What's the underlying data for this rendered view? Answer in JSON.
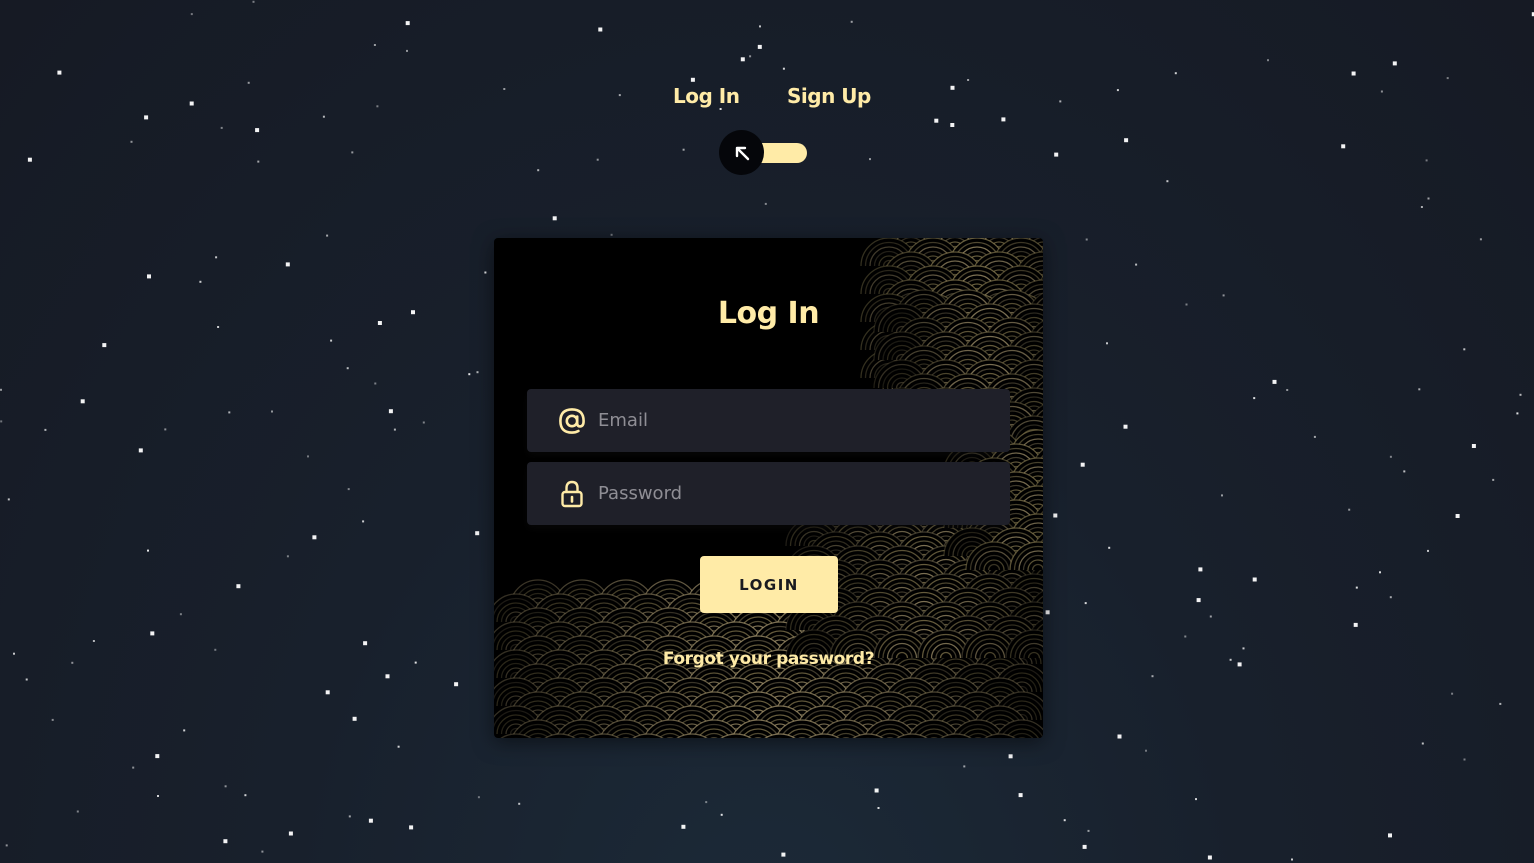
{
  "theme": {
    "accent": "#ffeba7",
    "card_background": "#000000",
    "field_background": "#1f2029",
    "page_background": "#18202c"
  },
  "mode_switch": {
    "login_label": "Log In",
    "signup_label": "Sign Up",
    "toggle_icon": "arrow-up-left-icon",
    "toggle_state": "login"
  },
  "login_card": {
    "title": "Log In",
    "email": {
      "value": "",
      "placeholder": "Email",
      "icon": "at-sign-icon"
    },
    "password": {
      "value": "",
      "placeholder": "Password",
      "icon": "lock-icon"
    },
    "submit_label": "LOGIN",
    "forgot_link": "Forgot your password?"
  }
}
